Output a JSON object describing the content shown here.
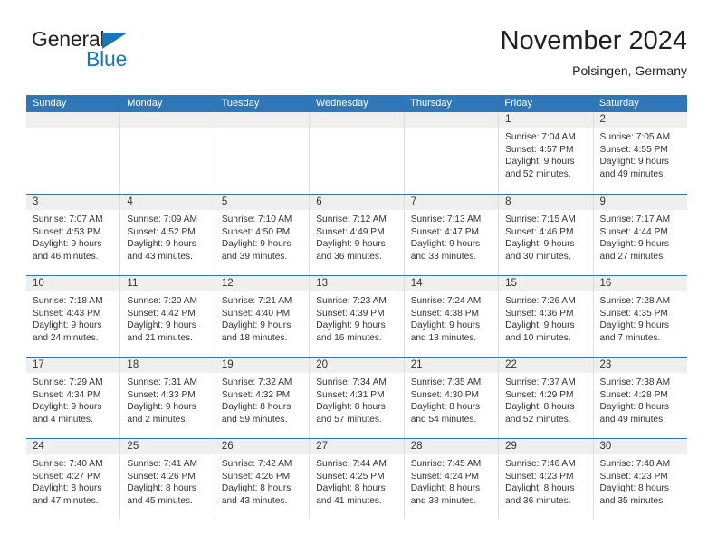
{
  "brand": {
    "name_top": "General",
    "name_bottom": "Blue",
    "color_dark": "#231f20",
    "color_blue": "#1b75bb"
  },
  "header": {
    "title": "November 2024",
    "location": "Polsingen, Germany",
    "header_bg": "#3077b8",
    "daynum_bg": "#efefef"
  },
  "weekday_headers": [
    "Sunday",
    "Monday",
    "Tuesday",
    "Wednesday",
    "Thursday",
    "Friday",
    "Saturday"
  ],
  "weeks": [
    [
      {
        "day": "",
        "sunrise": "",
        "sunset": "",
        "daylight_line1": "",
        "daylight_line2": "",
        "empty": true
      },
      {
        "day": "",
        "sunrise": "",
        "sunset": "",
        "daylight_line1": "",
        "daylight_line2": "",
        "empty": true
      },
      {
        "day": "",
        "sunrise": "",
        "sunset": "",
        "daylight_line1": "",
        "daylight_line2": "",
        "empty": true
      },
      {
        "day": "",
        "sunrise": "",
        "sunset": "",
        "daylight_line1": "",
        "daylight_line2": "",
        "empty": true
      },
      {
        "day": "",
        "sunrise": "",
        "sunset": "",
        "daylight_line1": "",
        "daylight_line2": "",
        "empty": true
      },
      {
        "day": "1",
        "sunrise": "Sunrise: 7:04 AM",
        "sunset": "Sunset: 4:57 PM",
        "daylight_line1": "Daylight: 9 hours",
        "daylight_line2": "and 52 minutes.",
        "empty": false
      },
      {
        "day": "2",
        "sunrise": "Sunrise: 7:05 AM",
        "sunset": "Sunset: 4:55 PM",
        "daylight_line1": "Daylight: 9 hours",
        "daylight_line2": "and 49 minutes.",
        "empty": false
      }
    ],
    [
      {
        "day": "3",
        "sunrise": "Sunrise: 7:07 AM",
        "sunset": "Sunset: 4:53 PM",
        "daylight_line1": "Daylight: 9 hours",
        "daylight_line2": "and 46 minutes.",
        "empty": false
      },
      {
        "day": "4",
        "sunrise": "Sunrise: 7:09 AM",
        "sunset": "Sunset: 4:52 PM",
        "daylight_line1": "Daylight: 9 hours",
        "daylight_line2": "and 43 minutes.",
        "empty": false
      },
      {
        "day": "5",
        "sunrise": "Sunrise: 7:10 AM",
        "sunset": "Sunset: 4:50 PM",
        "daylight_line1": "Daylight: 9 hours",
        "daylight_line2": "and 39 minutes.",
        "empty": false
      },
      {
        "day": "6",
        "sunrise": "Sunrise: 7:12 AM",
        "sunset": "Sunset: 4:49 PM",
        "daylight_line1": "Daylight: 9 hours",
        "daylight_line2": "and 36 minutes.",
        "empty": false
      },
      {
        "day": "7",
        "sunrise": "Sunrise: 7:13 AM",
        "sunset": "Sunset: 4:47 PM",
        "daylight_line1": "Daylight: 9 hours",
        "daylight_line2": "and 33 minutes.",
        "empty": false
      },
      {
        "day": "8",
        "sunrise": "Sunrise: 7:15 AM",
        "sunset": "Sunset: 4:46 PM",
        "daylight_line1": "Daylight: 9 hours",
        "daylight_line2": "and 30 minutes.",
        "empty": false
      },
      {
        "day": "9",
        "sunrise": "Sunrise: 7:17 AM",
        "sunset": "Sunset: 4:44 PM",
        "daylight_line1": "Daylight: 9 hours",
        "daylight_line2": "and 27 minutes.",
        "empty": false
      }
    ],
    [
      {
        "day": "10",
        "sunrise": "Sunrise: 7:18 AM",
        "sunset": "Sunset: 4:43 PM",
        "daylight_line1": "Daylight: 9 hours",
        "daylight_line2": "and 24 minutes.",
        "empty": false
      },
      {
        "day": "11",
        "sunrise": "Sunrise: 7:20 AM",
        "sunset": "Sunset: 4:42 PM",
        "daylight_line1": "Daylight: 9 hours",
        "daylight_line2": "and 21 minutes.",
        "empty": false
      },
      {
        "day": "12",
        "sunrise": "Sunrise: 7:21 AM",
        "sunset": "Sunset: 4:40 PM",
        "daylight_line1": "Daylight: 9 hours",
        "daylight_line2": "and 18 minutes.",
        "empty": false
      },
      {
        "day": "13",
        "sunrise": "Sunrise: 7:23 AM",
        "sunset": "Sunset: 4:39 PM",
        "daylight_line1": "Daylight: 9 hours",
        "daylight_line2": "and 16 minutes.",
        "empty": false
      },
      {
        "day": "14",
        "sunrise": "Sunrise: 7:24 AM",
        "sunset": "Sunset: 4:38 PM",
        "daylight_line1": "Daylight: 9 hours",
        "daylight_line2": "and 13 minutes.",
        "empty": false
      },
      {
        "day": "15",
        "sunrise": "Sunrise: 7:26 AM",
        "sunset": "Sunset: 4:36 PM",
        "daylight_line1": "Daylight: 9 hours",
        "daylight_line2": "and 10 minutes.",
        "empty": false
      },
      {
        "day": "16",
        "sunrise": "Sunrise: 7:28 AM",
        "sunset": "Sunset: 4:35 PM",
        "daylight_line1": "Daylight: 9 hours",
        "daylight_line2": "and 7 minutes.",
        "empty": false
      }
    ],
    [
      {
        "day": "17",
        "sunrise": "Sunrise: 7:29 AM",
        "sunset": "Sunset: 4:34 PM",
        "daylight_line1": "Daylight: 9 hours",
        "daylight_line2": "and 4 minutes.",
        "empty": false
      },
      {
        "day": "18",
        "sunrise": "Sunrise: 7:31 AM",
        "sunset": "Sunset: 4:33 PM",
        "daylight_line1": "Daylight: 9 hours",
        "daylight_line2": "and 2 minutes.",
        "empty": false
      },
      {
        "day": "19",
        "sunrise": "Sunrise: 7:32 AM",
        "sunset": "Sunset: 4:32 PM",
        "daylight_line1": "Daylight: 8 hours",
        "daylight_line2": "and 59 minutes.",
        "empty": false
      },
      {
        "day": "20",
        "sunrise": "Sunrise: 7:34 AM",
        "sunset": "Sunset: 4:31 PM",
        "daylight_line1": "Daylight: 8 hours",
        "daylight_line2": "and 57 minutes.",
        "empty": false
      },
      {
        "day": "21",
        "sunrise": "Sunrise: 7:35 AM",
        "sunset": "Sunset: 4:30 PM",
        "daylight_line1": "Daylight: 8 hours",
        "daylight_line2": "and 54 minutes.",
        "empty": false
      },
      {
        "day": "22",
        "sunrise": "Sunrise: 7:37 AM",
        "sunset": "Sunset: 4:29 PM",
        "daylight_line1": "Daylight: 8 hours",
        "daylight_line2": "and 52 minutes.",
        "empty": false
      },
      {
        "day": "23",
        "sunrise": "Sunrise: 7:38 AM",
        "sunset": "Sunset: 4:28 PM",
        "daylight_line1": "Daylight: 8 hours",
        "daylight_line2": "and 49 minutes.",
        "empty": false
      }
    ],
    [
      {
        "day": "24",
        "sunrise": "Sunrise: 7:40 AM",
        "sunset": "Sunset: 4:27 PM",
        "daylight_line1": "Daylight: 8 hours",
        "daylight_line2": "and 47 minutes.",
        "empty": false
      },
      {
        "day": "25",
        "sunrise": "Sunrise: 7:41 AM",
        "sunset": "Sunset: 4:26 PM",
        "daylight_line1": "Daylight: 8 hours",
        "daylight_line2": "and 45 minutes.",
        "empty": false
      },
      {
        "day": "26",
        "sunrise": "Sunrise: 7:42 AM",
        "sunset": "Sunset: 4:26 PM",
        "daylight_line1": "Daylight: 8 hours",
        "daylight_line2": "and 43 minutes.",
        "empty": false
      },
      {
        "day": "27",
        "sunrise": "Sunrise: 7:44 AM",
        "sunset": "Sunset: 4:25 PM",
        "daylight_line1": "Daylight: 8 hours",
        "daylight_line2": "and 41 minutes.",
        "empty": false
      },
      {
        "day": "28",
        "sunrise": "Sunrise: 7:45 AM",
        "sunset": "Sunset: 4:24 PM",
        "daylight_line1": "Daylight: 8 hours",
        "daylight_line2": "and 38 minutes.",
        "empty": false
      },
      {
        "day": "29",
        "sunrise": "Sunrise: 7:46 AM",
        "sunset": "Sunset: 4:23 PM",
        "daylight_line1": "Daylight: 8 hours",
        "daylight_line2": "and 36 minutes.",
        "empty": false
      },
      {
        "day": "30",
        "sunrise": "Sunrise: 7:48 AM",
        "sunset": "Sunset: 4:23 PM",
        "daylight_line1": "Daylight: 8 hours",
        "daylight_line2": "and 35 minutes.",
        "empty": false
      }
    ]
  ]
}
